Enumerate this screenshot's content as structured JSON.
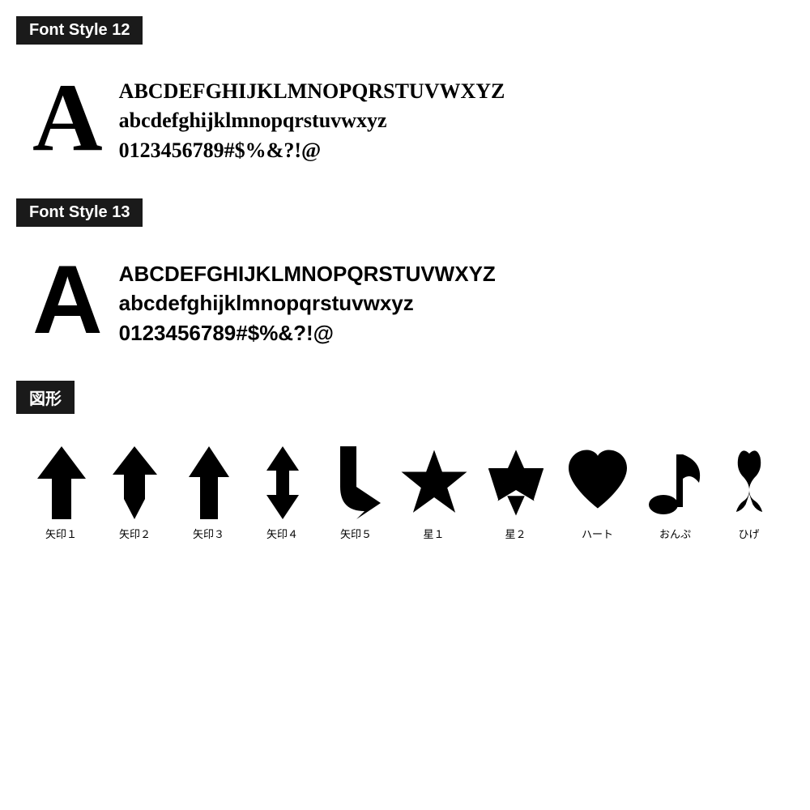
{
  "sections": [
    {
      "id": "font-style-12",
      "header": "Font Style 12",
      "big_letter": "A",
      "lines": [
        "ABCDEFGHIJKLMNOPQRSTUVWXYZ",
        "abcdefghijklmnopqrstuvwxyz",
        "0123456789#$%&?!@"
      ],
      "style_class": "style12"
    },
    {
      "id": "font-style-13",
      "header": "Font Style 13",
      "big_letter": "A",
      "lines": [
        "ABCDEFGHIJKLMNOPQRSTUVWXYZ",
        "abcdefghijklmnopqrstuvwxyz",
        "0123456789#$%&?!@"
      ],
      "style_class": "style13"
    },
    {
      "id": "shapes",
      "header": "図形",
      "shapes": [
        {
          "id": "arrow1",
          "label": "矢印１"
        },
        {
          "id": "arrow2",
          "label": "矢印２"
        },
        {
          "id": "arrow3",
          "label": "矢印３"
        },
        {
          "id": "arrow4",
          "label": "矢印４"
        },
        {
          "id": "arrow5",
          "label": "矢印５"
        },
        {
          "id": "star1",
          "label": "星１"
        },
        {
          "id": "star2",
          "label": "星２"
        },
        {
          "id": "heart",
          "label": "ハート"
        },
        {
          "id": "music",
          "label": "おんぷ"
        },
        {
          "id": "mustache",
          "label": "ひげ"
        }
      ]
    }
  ]
}
